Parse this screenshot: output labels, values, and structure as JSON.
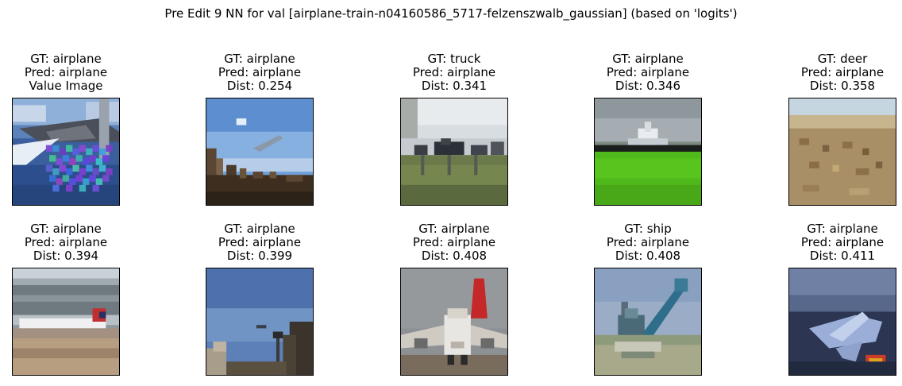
{
  "figure": {
    "title": "Pre Edit 9 NN for val [airplane-train-n04160586_5717-felzenszwalb_gaussian] (based on 'logits')"
  },
  "panels": [
    {
      "gt": "GT: airplane",
      "pred": "Pred: airplane",
      "info": "Value Image",
      "scene": "query-airplane-noise"
    },
    {
      "gt": "GT: airplane",
      "pred": "Pred: airplane",
      "info": "Dist: 0.254",
      "scene": "sky-plane-buildings"
    },
    {
      "gt": "GT: truck",
      "pred": "Pred: airplane",
      "info": "Dist: 0.341",
      "scene": "grass-field-vehicles"
    },
    {
      "gt": "GT: airplane",
      "pred": "Pred: airplane",
      "info": "Dist: 0.346",
      "scene": "plane-over-green-field"
    },
    {
      "gt": "GT: deer",
      "pred": "Pred: airplane",
      "info": "Dist: 0.358",
      "scene": "desert-deer"
    },
    {
      "gt": "GT: airplane",
      "pred": "Pred: airplane",
      "info": "Dist: 0.394",
      "scene": "airport-jet-runway"
    },
    {
      "gt": "GT: airplane",
      "pred": "Pred: airplane",
      "info": "Dist: 0.399",
      "scene": "blue-sky-poles"
    },
    {
      "gt": "GT: airplane",
      "pred": "Pred: airplane",
      "info": "Dist: 0.408",
      "scene": "jumbo-jet-front"
    },
    {
      "gt": "GT: ship",
      "pred": "Pred: airplane",
      "info": "Dist: 0.408",
      "scene": "ship-crane"
    },
    {
      "gt": "GT: airplane",
      "pred": "Pred: airplane",
      "info": "Dist: 0.411",
      "scene": "jet-over-water"
    }
  ]
}
